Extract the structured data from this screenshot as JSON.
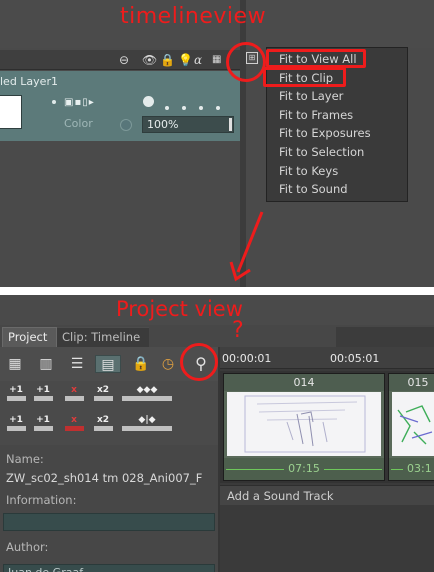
{
  "annotations": {
    "top_label": "timelineview",
    "bottom_label": "Project view",
    "question_mark": "?"
  },
  "colors": {
    "annotation_red": "#ee1c1c",
    "layer_row": "#5c7a7a",
    "clip_duration_green": "#6ec75b"
  },
  "layer_panel": {
    "header_icons": [
      "minus-circle-icon",
      "eye-icon",
      "lock-icon",
      "bulb-icon",
      "alpha-icon",
      "grid-icon",
      "zoom-menu-icon"
    ],
    "layer_name": "led Layer1",
    "color_label": "Color",
    "opacity_value": "100%"
  },
  "zoom_menu": {
    "items": [
      "Fit to View All",
      "Fit to Clip",
      "Fit to Layer",
      "Fit to Frames",
      "Fit to Exposures",
      "Fit to Selection",
      "Fit to Keys",
      "Fit to Sound"
    ]
  },
  "project_panel": {
    "tabs": [
      "Project",
      "Clip: Timeline"
    ],
    "toolbar_icons": [
      "grid-view-icon",
      "thumbnail-view-icon",
      "list-view-icon",
      "timeline-view-icon",
      "lock-icon",
      "clock-icon",
      "search-icon"
    ],
    "key_buttons": {
      "row1": [
        "+1",
        "+1",
        "x",
        "x2",
        "◆◆◆"
      ],
      "row2": [
        "+1",
        "+1",
        "x",
        "x2",
        "◆|◆"
      ]
    },
    "name_label": "Name:",
    "name_value": "ZW_sc02_sh014 tm 028_Ani007_F",
    "information_label": "Information:",
    "author_label": "Author:",
    "author_value": "Juan de Graaf"
  },
  "timeline": {
    "timecodes": [
      "00:00:01",
      "00:05:01"
    ],
    "clips": [
      {
        "title": "014",
        "duration": "07:15"
      },
      {
        "title": "015",
        "duration": "03:1"
      }
    ],
    "sound_track_label": "Add a Sound Track"
  }
}
